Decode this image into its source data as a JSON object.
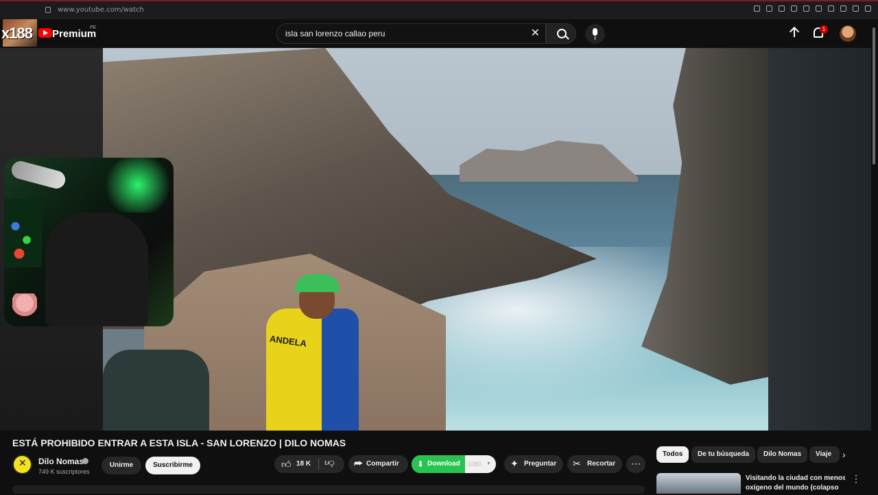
{
  "browser": {
    "url": "www.youtube.com/watch"
  },
  "header": {
    "overlay_text": "x188",
    "brand": "Premium",
    "region": "PE",
    "search_value": "isla san lorenzo callao peru",
    "notifications_count": "1"
  },
  "video": {
    "title": "ESTÁ PROHIBIDO ENTRAR A ESTA ISLA - SAN LORENZO | DILO NOMAS",
    "shirt_text": "ANDELA"
  },
  "channel": {
    "name": "Dilo Nomas",
    "subscribers": "749 K suscriptores",
    "join_label": "Unirme",
    "subscribe_label": "Suscribirme"
  },
  "actions": {
    "likes": "18 K",
    "share_label": "Compartir",
    "download_label": "Download",
    "quality": "1080",
    "ask_label": "Preguntar",
    "clip_label": "Recortar",
    "more": "⋯"
  },
  "chips": [
    "Todos",
    "De tu búsqueda",
    "Dilo Nomas",
    "Viaje"
  ],
  "recommended": {
    "title_line1": "Visitando la ciudad con menos",
    "title_line2": "oxígeno del mundo (colapso"
  },
  "colors": {
    "background": "#0f0f0f",
    "youtube_red": "#ff0000",
    "download_green": "#27c451"
  }
}
